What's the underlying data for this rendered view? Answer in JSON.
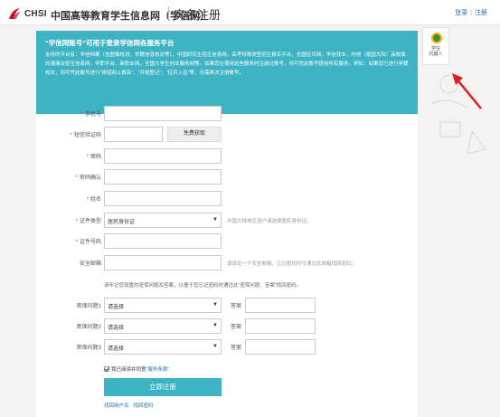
{
  "header": {
    "logo_text": "CHSI",
    "site_name": "中国高等教育学生信息网（学信网）",
    "page_title": "实名注册",
    "login": "登录",
    "sep": "|",
    "register": "注册"
  },
  "notice": {
    "title": "“学信网账号”可用于登录学信网各服务平台",
    "body": "支持的平台有：学信档案（含图像校对、学籍信息核对等），中国研究生招生信息网，高考特殊类型招生报名平台，全国征兵网，学信就业，内地（祖国大陆）高校面向港澳台招生信息网，学职平台，新职业网，全国大学生创业服务网等。如果您在使用这些服务时注册过账号，则可凭此账号使用所有服务，例如：如果您已进行学籍校对，则可凭此账号进行“研招网上报名”、“兵役登记”、“征兵入伍”等，无需再次注册账号。"
  },
  "form": {
    "phone_label": "手机号",
    "sms_label": "短信验证码",
    "sms_button": "免费获取",
    "password_label": "密码",
    "password_confirm_label": "密码确认",
    "name_label": "姓名",
    "id_type_label": "证件类型",
    "id_type_value": "居民身份证",
    "id_type_hint": "中国大陆地区用户请选择居民身份证。",
    "id_number_label": "证件号码",
    "email_label": "安全邮箱",
    "email_hint": "请设定一个安全邮箱，忘记密码时可通过此邮箱找回密码。",
    "security_hint": "请牢记您设置的密保问题及答案，以便于您忘记密码时通过此“密保问题、答案”找回密码。",
    "question1_label": "密保问题1",
    "question2_label": "密保问题2",
    "question3_label": "密保问题3",
    "question_placeholder": "请选择",
    "answer_label": "答案",
    "agree_text": "我已阅读并同意",
    "agree_link": "“服务条款”",
    "submit": "立即注册",
    "find_username": "找回用户名",
    "find_password": "找回密码"
  },
  "robot": {
    "label_line1": "学信",
    "label_line2": "机器人"
  },
  "colors": {
    "accent": "#3eb3c4",
    "link": "#1a6fb3",
    "required": "#e4393c",
    "arrow": "#e02020"
  }
}
